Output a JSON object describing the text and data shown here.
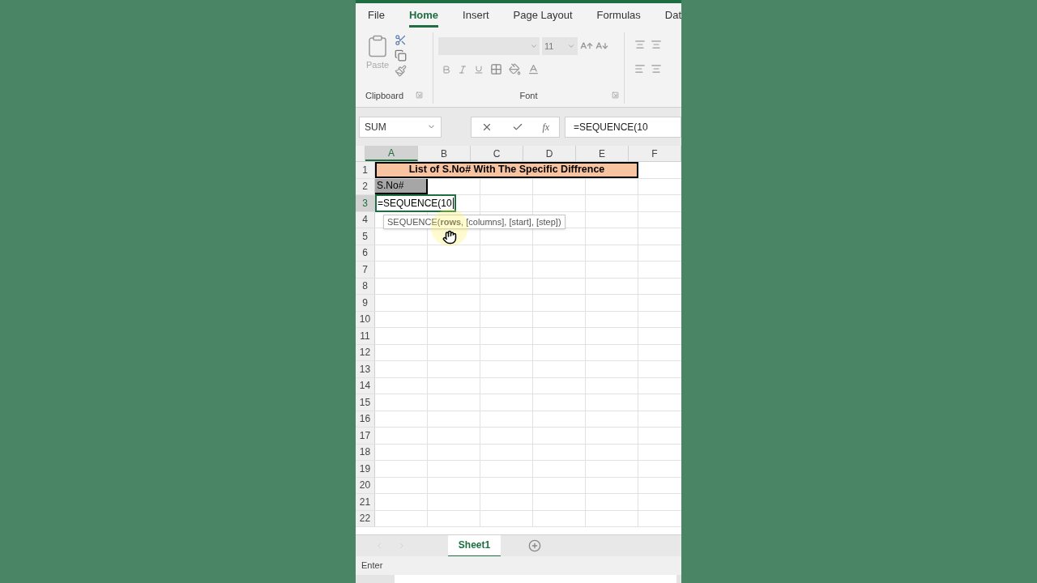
{
  "ribbon_tabs": [
    {
      "label": "File",
      "selected": false
    },
    {
      "label": "Home",
      "selected": true
    },
    {
      "label": "Insert",
      "selected": false
    },
    {
      "label": "Page Layout",
      "selected": false
    },
    {
      "label": "Formulas",
      "selected": false
    },
    {
      "label": "Dat",
      "selected": false
    }
  ],
  "ribbon": {
    "paste_label": "Paste",
    "clipboard_label": "Clipboard",
    "font_size": "11",
    "font_label": "Font"
  },
  "formula_bar": {
    "name_box": "SUM",
    "function_label": "fx",
    "formula": "=SEQUENCE(10"
  },
  "columns": [
    {
      "label": "A",
      "selected": true
    },
    {
      "label": "B",
      "selected": false
    },
    {
      "label": "C",
      "selected": false
    },
    {
      "label": "D",
      "selected": false
    },
    {
      "label": "E",
      "selected": false
    },
    {
      "label": "F",
      "selected": false
    }
  ],
  "rows": [
    {
      "label": "1",
      "selected": false
    },
    {
      "label": "2",
      "selected": false
    },
    {
      "label": "3",
      "selected": true
    },
    {
      "label": "4",
      "selected": false
    },
    {
      "label": "5",
      "selected": false
    },
    {
      "label": "6",
      "selected": false
    },
    {
      "label": "7",
      "selected": false
    },
    {
      "label": "8",
      "selected": false
    },
    {
      "label": "9",
      "selected": false
    },
    {
      "label": "10",
      "selected": false
    },
    {
      "label": "11",
      "selected": false
    },
    {
      "label": "12",
      "selected": false
    },
    {
      "label": "13",
      "selected": false
    },
    {
      "label": "14",
      "selected": false
    },
    {
      "label": "15",
      "selected": false
    },
    {
      "label": "16",
      "selected": false
    },
    {
      "label": "17",
      "selected": false
    },
    {
      "label": "18",
      "selected": false
    },
    {
      "label": "19",
      "selected": false
    },
    {
      "label": "20",
      "selected": false
    },
    {
      "label": "21",
      "selected": false
    },
    {
      "label": "22",
      "selected": false
    }
  ],
  "cells": {
    "title": "List of S.No# With The Specific Diffrence",
    "header": "S.No#",
    "editing": "=SEQUENCE(10"
  },
  "tooltip": "SEQUENCE(**rows**, [columns], [start], [step])",
  "sheet_tabs": [
    {
      "label": "Sheet1",
      "selected": true
    }
  ],
  "status_bar": {
    "mode": "Enter"
  }
}
